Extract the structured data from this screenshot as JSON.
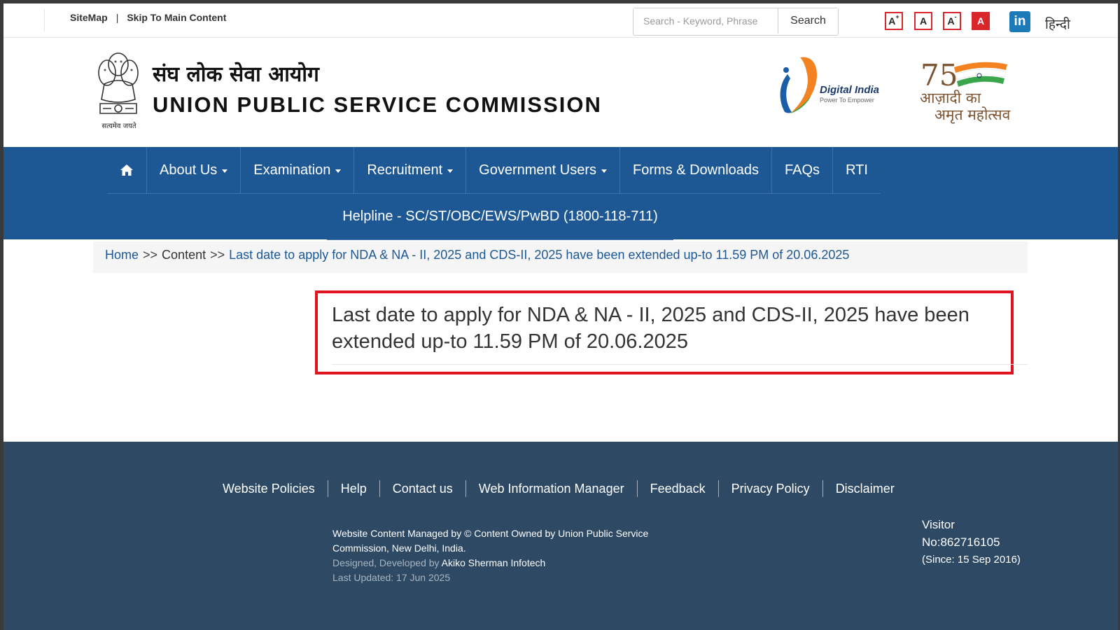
{
  "topbar": {
    "sitemap": "SiteMap",
    "separator": "|",
    "skip": "Skip To Main Content",
    "search_placeholder": "Search - Keyword, Phrase",
    "search_button": "Search",
    "font_increase": "A",
    "font_increase_sup": "+",
    "font_normal": "A",
    "font_decrease": "A",
    "font_decrease_sup": "-",
    "contrast": "A",
    "linkedin": "in",
    "hindi": "हिन्दी"
  },
  "header": {
    "hindi_name": "संघ लोक सेवा आयोग",
    "english_name": "UNION PUBLIC SERVICE COMMISSION",
    "emblem_motto": "सत्यमेव जयते",
    "digital_india": "Digital India",
    "digital_india_sub": "Power To Empower",
    "azadi_line1": "आज़ादी का",
    "azadi_line2": "अमृत महोत्सव",
    "azadi_number": "75"
  },
  "nav": {
    "items": [
      {
        "label": "About Us",
        "dropdown": true
      },
      {
        "label": "Examination",
        "dropdown": true
      },
      {
        "label": "Recruitment",
        "dropdown": true
      },
      {
        "label": "Government Users",
        "dropdown": true
      },
      {
        "label": "Forms & Downloads",
        "dropdown": false
      },
      {
        "label": "FAQs",
        "dropdown": false
      },
      {
        "label": "RTI",
        "dropdown": false
      }
    ],
    "helpline": "Helpline - SC/ST/OBC/EWS/PwBD (1800-118-711)"
  },
  "breadcrumb": {
    "home": "Home",
    "sep": ">>",
    "content": "Content",
    "current": "Last date to apply for NDA & NA - II, 2025 and CDS-II, 2025 have been extended up-to 11.59 PM of 20.06.2025"
  },
  "content": {
    "title": "Last date to apply for NDA & NA - II, 2025 and CDS-II, 2025 have been extended up-to 11.59 PM of 20.06.2025"
  },
  "footer": {
    "links": [
      "Website Policies",
      "Help",
      "Contact us",
      "Web Information Manager",
      "Feedback",
      "Privacy Policy",
      "Disclaimer"
    ],
    "managed": "Website Content Managed by © Content Owned by Union Public Service Commission, New Delhi, India.",
    "designed_prefix": "Designed, Developed by",
    "designed_by": "Akiko Sherman Infotech",
    "last_updated": "Last Updated: 17 Jun 2025",
    "visitor_label": "Visitor",
    "visitor_count": "No:862716105",
    "visitor_since": "(Since: 15 Sep 2016)"
  },
  "colors": {
    "nav_blue": "#1d5895",
    "footer_navy": "#2d4964",
    "highlight_red": "#e0141e",
    "font_btn_red": "#d9262b"
  },
  "icons": {
    "home": "home-icon",
    "linkedin": "linkedin-icon",
    "caret": "caret-down-icon",
    "emblem": "national-emblem-icon",
    "digital_india": "digital-india-logo",
    "azadi": "azadi-ka-amrit-mahotsav-logo"
  }
}
